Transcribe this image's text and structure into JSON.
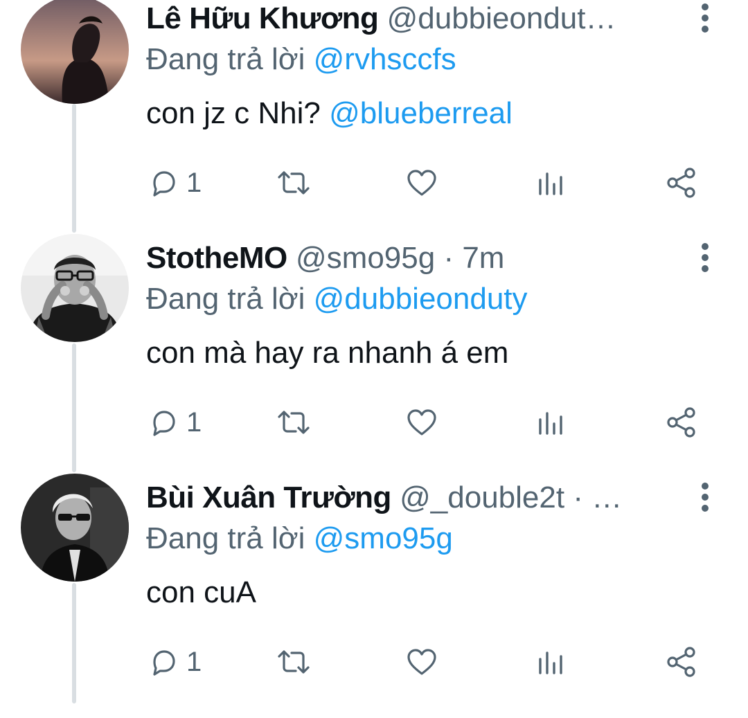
{
  "colors": {
    "accent": "#1d9bf0",
    "secondary_text": "#536471",
    "primary_text": "#0f1419",
    "thread_line": "#d9dee2"
  },
  "tweets": [
    {
      "display_name": "Lê Hữu Khương",
      "handle": "@dubbieondut…",
      "time": "",
      "replying_label": "Đang trả lời",
      "replying_to": "@rvhsccfs",
      "body_text": "con jz c Nhi? ",
      "body_mention": "@blueberreal",
      "reply_count": "1",
      "avatar": "user-avatar-1"
    },
    {
      "display_name": "StotheMO",
      "handle": "@smo95g",
      "time": "· 7m",
      "replying_label": "Đang trả lời",
      "replying_to": "@dubbieonduty",
      "body_text": "con mà hay ra nhanh á em",
      "body_mention": "",
      "reply_count": "1",
      "avatar": "user-avatar-2"
    },
    {
      "display_name": "Bùi Xuân Trường",
      "handle": "@_double2t",
      "time": "· …",
      "replying_label": "Đang trả lời",
      "replying_to": "@smo95g",
      "body_text": "con cuA",
      "body_mention": "",
      "reply_count": "1",
      "avatar": "user-avatar-3"
    }
  ],
  "icons": {
    "reply": "reply-icon",
    "retweet": "retweet-icon",
    "like": "heart-icon",
    "views": "analytics-icon",
    "share": "share-icon",
    "more": "more-vertical-icon"
  }
}
